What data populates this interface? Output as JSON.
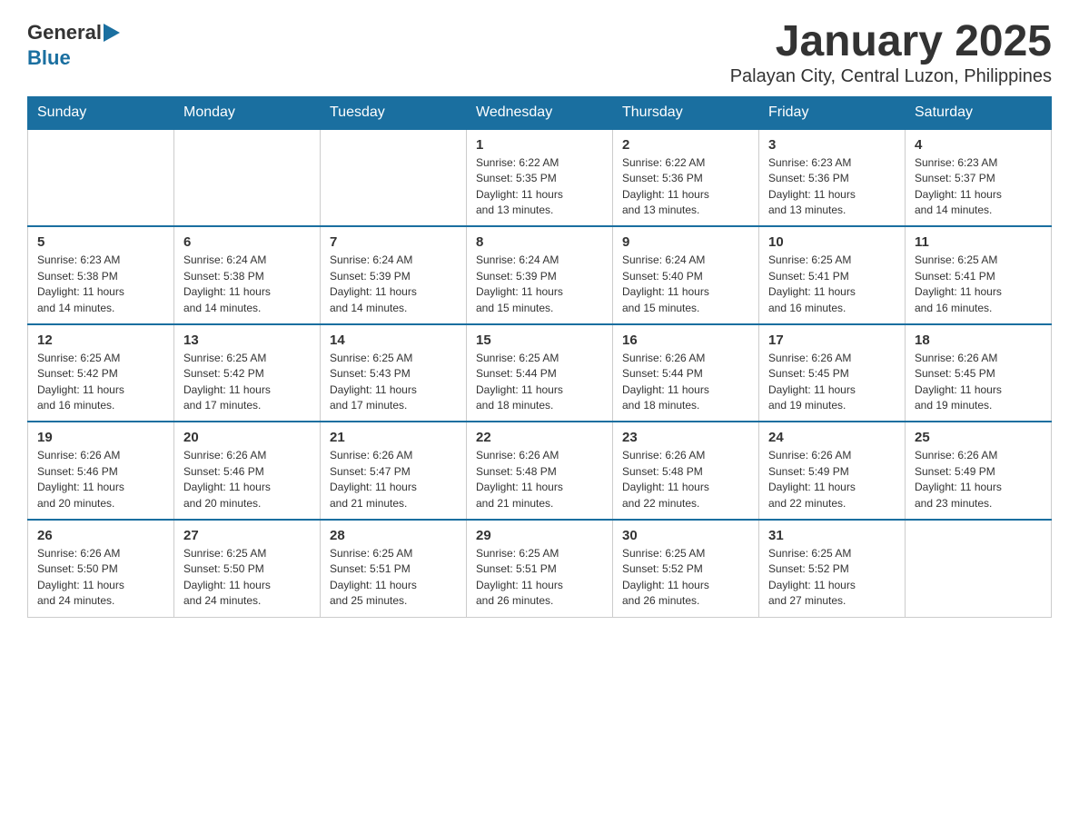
{
  "logo": {
    "general": "General",
    "blue": "Blue"
  },
  "title": "January 2025",
  "subtitle": "Palayan City, Central Luzon, Philippines",
  "weekdays": [
    "Sunday",
    "Monday",
    "Tuesday",
    "Wednesday",
    "Thursday",
    "Friday",
    "Saturday"
  ],
  "weeks": [
    [
      {
        "day": "",
        "info": ""
      },
      {
        "day": "",
        "info": ""
      },
      {
        "day": "",
        "info": ""
      },
      {
        "day": "1",
        "info": "Sunrise: 6:22 AM\nSunset: 5:35 PM\nDaylight: 11 hours\nand 13 minutes."
      },
      {
        "day": "2",
        "info": "Sunrise: 6:22 AM\nSunset: 5:36 PM\nDaylight: 11 hours\nand 13 minutes."
      },
      {
        "day": "3",
        "info": "Sunrise: 6:23 AM\nSunset: 5:36 PM\nDaylight: 11 hours\nand 13 minutes."
      },
      {
        "day": "4",
        "info": "Sunrise: 6:23 AM\nSunset: 5:37 PM\nDaylight: 11 hours\nand 14 minutes."
      }
    ],
    [
      {
        "day": "5",
        "info": "Sunrise: 6:23 AM\nSunset: 5:38 PM\nDaylight: 11 hours\nand 14 minutes."
      },
      {
        "day": "6",
        "info": "Sunrise: 6:24 AM\nSunset: 5:38 PM\nDaylight: 11 hours\nand 14 minutes."
      },
      {
        "day": "7",
        "info": "Sunrise: 6:24 AM\nSunset: 5:39 PM\nDaylight: 11 hours\nand 14 minutes."
      },
      {
        "day": "8",
        "info": "Sunrise: 6:24 AM\nSunset: 5:39 PM\nDaylight: 11 hours\nand 15 minutes."
      },
      {
        "day": "9",
        "info": "Sunrise: 6:24 AM\nSunset: 5:40 PM\nDaylight: 11 hours\nand 15 minutes."
      },
      {
        "day": "10",
        "info": "Sunrise: 6:25 AM\nSunset: 5:41 PM\nDaylight: 11 hours\nand 16 minutes."
      },
      {
        "day": "11",
        "info": "Sunrise: 6:25 AM\nSunset: 5:41 PM\nDaylight: 11 hours\nand 16 minutes."
      }
    ],
    [
      {
        "day": "12",
        "info": "Sunrise: 6:25 AM\nSunset: 5:42 PM\nDaylight: 11 hours\nand 16 minutes."
      },
      {
        "day": "13",
        "info": "Sunrise: 6:25 AM\nSunset: 5:42 PM\nDaylight: 11 hours\nand 17 minutes."
      },
      {
        "day": "14",
        "info": "Sunrise: 6:25 AM\nSunset: 5:43 PM\nDaylight: 11 hours\nand 17 minutes."
      },
      {
        "day": "15",
        "info": "Sunrise: 6:25 AM\nSunset: 5:44 PM\nDaylight: 11 hours\nand 18 minutes."
      },
      {
        "day": "16",
        "info": "Sunrise: 6:26 AM\nSunset: 5:44 PM\nDaylight: 11 hours\nand 18 minutes."
      },
      {
        "day": "17",
        "info": "Sunrise: 6:26 AM\nSunset: 5:45 PM\nDaylight: 11 hours\nand 19 minutes."
      },
      {
        "day": "18",
        "info": "Sunrise: 6:26 AM\nSunset: 5:45 PM\nDaylight: 11 hours\nand 19 minutes."
      }
    ],
    [
      {
        "day": "19",
        "info": "Sunrise: 6:26 AM\nSunset: 5:46 PM\nDaylight: 11 hours\nand 20 minutes."
      },
      {
        "day": "20",
        "info": "Sunrise: 6:26 AM\nSunset: 5:46 PM\nDaylight: 11 hours\nand 20 minutes."
      },
      {
        "day": "21",
        "info": "Sunrise: 6:26 AM\nSunset: 5:47 PM\nDaylight: 11 hours\nand 21 minutes."
      },
      {
        "day": "22",
        "info": "Sunrise: 6:26 AM\nSunset: 5:48 PM\nDaylight: 11 hours\nand 21 minutes."
      },
      {
        "day": "23",
        "info": "Sunrise: 6:26 AM\nSunset: 5:48 PM\nDaylight: 11 hours\nand 22 minutes."
      },
      {
        "day": "24",
        "info": "Sunrise: 6:26 AM\nSunset: 5:49 PM\nDaylight: 11 hours\nand 22 minutes."
      },
      {
        "day": "25",
        "info": "Sunrise: 6:26 AM\nSunset: 5:49 PM\nDaylight: 11 hours\nand 23 minutes."
      }
    ],
    [
      {
        "day": "26",
        "info": "Sunrise: 6:26 AM\nSunset: 5:50 PM\nDaylight: 11 hours\nand 24 minutes."
      },
      {
        "day": "27",
        "info": "Sunrise: 6:25 AM\nSunset: 5:50 PM\nDaylight: 11 hours\nand 24 minutes."
      },
      {
        "day": "28",
        "info": "Sunrise: 6:25 AM\nSunset: 5:51 PM\nDaylight: 11 hours\nand 25 minutes."
      },
      {
        "day": "29",
        "info": "Sunrise: 6:25 AM\nSunset: 5:51 PM\nDaylight: 11 hours\nand 26 minutes."
      },
      {
        "day": "30",
        "info": "Sunrise: 6:25 AM\nSunset: 5:52 PM\nDaylight: 11 hours\nand 26 minutes."
      },
      {
        "day": "31",
        "info": "Sunrise: 6:25 AM\nSunset: 5:52 PM\nDaylight: 11 hours\nand 27 minutes."
      },
      {
        "day": "",
        "info": ""
      }
    ]
  ]
}
